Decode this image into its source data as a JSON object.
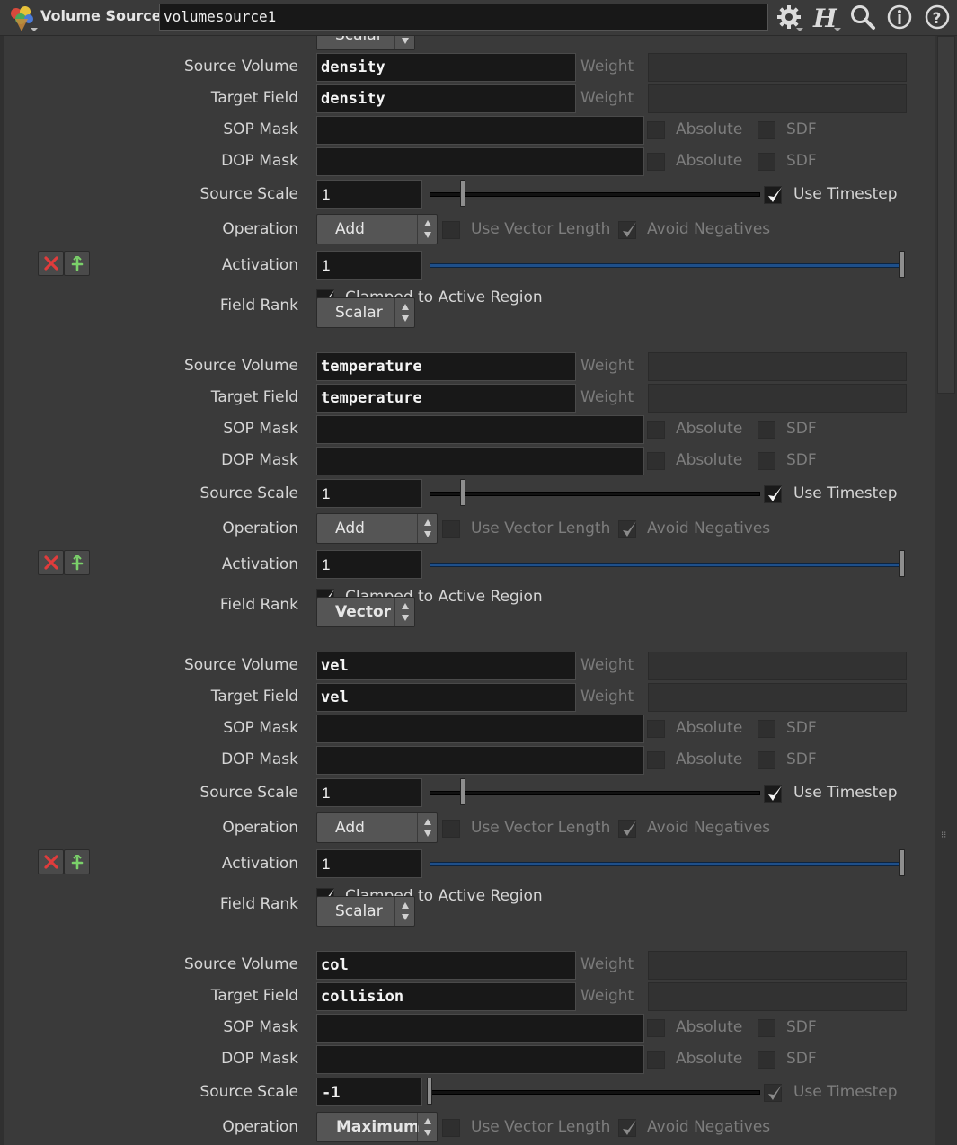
{
  "header": {
    "node_type": "Volume Source",
    "node_name": "volumesource1",
    "icons": [
      "node-type-icon",
      "gear-icon",
      "houdini-help-icon",
      "search-icon",
      "info-icon",
      "help-icon"
    ]
  },
  "common_labels": {
    "weight": "Weight",
    "absolute": "Absolute",
    "sdf": "SDF",
    "use_timestep": "Use Timestep",
    "use_vector_length": "Use Vector Length",
    "avoid_negatives": "Avoid Negatives",
    "clamped": "Clamped to Active Region"
  },
  "top_partial": {
    "label": "Field Rank",
    "value": "Scalar"
  },
  "sources": [
    {
      "source_volume_label": "Source Volume",
      "source_volume": "density",
      "target_field_label": "Target Field",
      "target_field": "density",
      "sop_mask_label": "SOP Mask",
      "dop_mask_label": "DOP Mask",
      "source_scale_label": "Source Scale",
      "source_scale": "1",
      "source_scale_fraction": 0.1,
      "operation_label": "Operation",
      "operation": "Add",
      "activation_label": "Activation",
      "activation": "1",
      "activation_fraction": 1.0,
      "use_timestep": true
    },
    {
      "field_rank_label": "Field Rank",
      "field_rank": "Scalar",
      "source_volume_label": "Source Volume",
      "source_volume": "temperature",
      "target_field_label": "Target Field",
      "target_field": "temperature",
      "sop_mask_label": "SOP Mask",
      "dop_mask_label": "DOP Mask",
      "source_scale_label": "Source Scale",
      "source_scale": "1",
      "source_scale_fraction": 0.1,
      "operation_label": "Operation",
      "operation": "Add",
      "activation_label": "Activation",
      "activation": "1",
      "activation_fraction": 1.0,
      "use_timestep": true
    },
    {
      "field_rank_label": "Field Rank",
      "field_rank": "Vector",
      "source_volume_label": "Source Volume",
      "source_volume": "vel",
      "target_field_label": "Target Field",
      "target_field": "vel",
      "sop_mask_label": "SOP Mask",
      "dop_mask_label": "DOP Mask",
      "source_scale_label": "Source Scale",
      "source_scale": "1",
      "source_scale_fraction": 0.1,
      "operation_label": "Operation",
      "operation": "Add",
      "activation_label": "Activation",
      "activation": "1",
      "activation_fraction": 1.0,
      "use_timestep": true
    },
    {
      "field_rank_label": "Field Rank",
      "field_rank": "Scalar",
      "source_volume_label": "Source Volume",
      "source_volume": "col",
      "target_field_label": "Target Field",
      "target_field": "collision",
      "sop_mask_label": "SOP Mask",
      "dop_mask_label": "DOP Mask",
      "source_scale_label": "Source Scale",
      "source_scale": "-1",
      "source_scale_fraction": 0.0,
      "operation_label": "Operation",
      "operation": "Maximum",
      "use_timestep": false
    }
  ]
}
